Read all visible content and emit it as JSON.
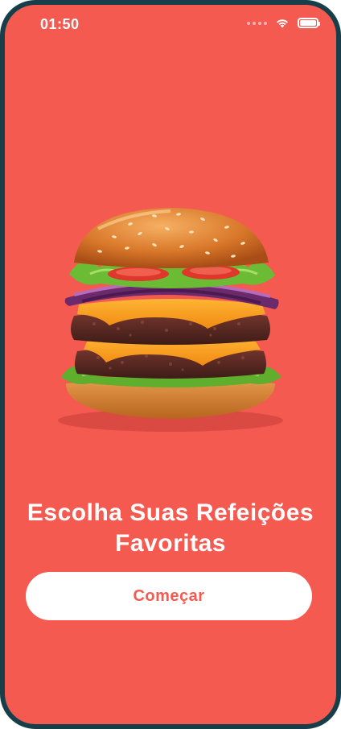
{
  "status_bar": {
    "time": "01:50",
    "wifi_icon": "wifi-icon",
    "battery_icon": "battery-icon"
  },
  "hero": {
    "image": "hamburger-image"
  },
  "headline": {
    "line1": "Escolha Suas Refeições",
    "line2": "Favoritas"
  },
  "start_button": {
    "label": "Começar"
  },
  "colors": {
    "background": "#f55a51",
    "frame": "#163f4a",
    "button_bg": "#ffffff",
    "button_text": "#f55a51"
  }
}
